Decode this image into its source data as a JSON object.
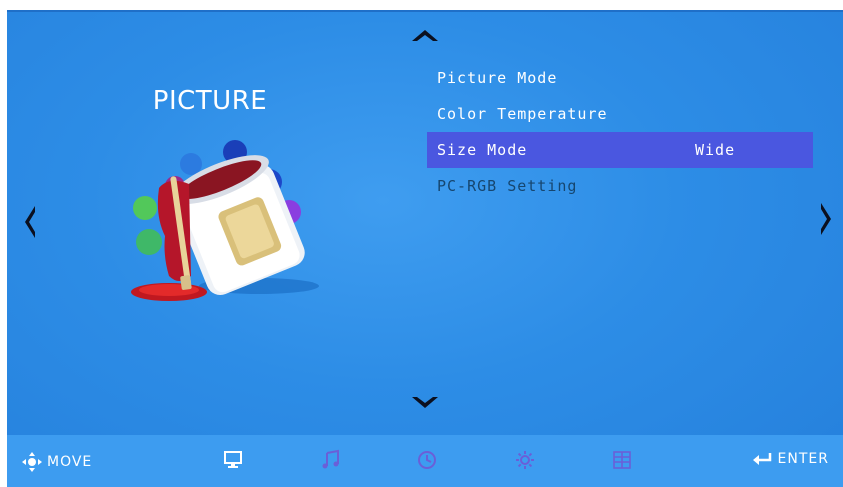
{
  "screen": {
    "title": "PICTURE",
    "menu": [
      {
        "label": "Picture Mode",
        "value": ""
      },
      {
        "label": "Color Temperature",
        "value": ""
      },
      {
        "label": "Size Mode",
        "value": "Wide",
        "selected": true
      },
      {
        "label": "PC-RGB Setting",
        "value": "",
        "disabled": true
      }
    ]
  },
  "footer": {
    "move_label": "MOVE",
    "enter_label": "ENTER",
    "icons": [
      "monitor-icon",
      "music-icon",
      "clock-icon",
      "gear-icon",
      "grid-icon"
    ]
  },
  "colors": {
    "background": "#2d8de6",
    "selected_row": "#4a57e0",
    "footer": "#3d9cf0",
    "disabled_text": "#16466f"
  }
}
